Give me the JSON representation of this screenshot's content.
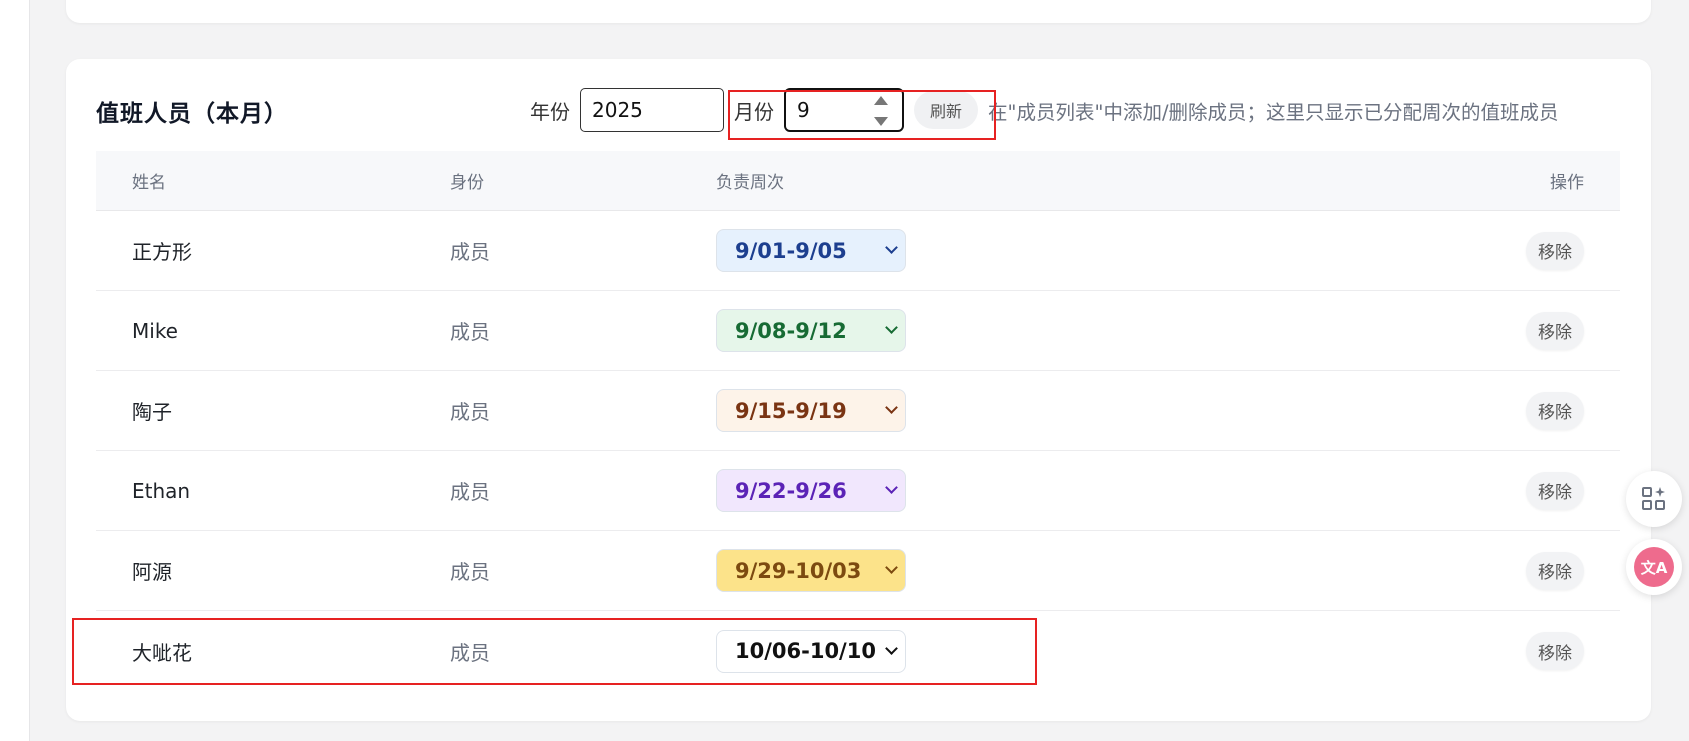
{
  "section": {
    "title": "值班人员（本月）"
  },
  "toolbar": {
    "year_label": "年份",
    "year_value": "2025",
    "month_label": "月份",
    "month_value": "9",
    "refresh_label": "刷新",
    "hint": "在\"成员列表\"中添加/删除成员；这里只显示已分配周次的值班成员"
  },
  "table": {
    "headers": {
      "name": "姓名",
      "role": "身份",
      "week": "负责周次",
      "action": "操作"
    },
    "rows": [
      {
        "name": "正方形",
        "role": "成员",
        "week": "9/01-9/05",
        "week_bg": "#e6f1fd",
        "week_fg": "#1d3f8f",
        "action": "移除"
      },
      {
        "name": "Mike",
        "role": "成员",
        "week": "9/08-9/12",
        "week_bg": "#e6f6ea",
        "week_fg": "#176b34",
        "action": "移除"
      },
      {
        "name": "陶子",
        "role": "成员",
        "week": "9/15-9/19",
        "week_bg": "#fdf3e9",
        "week_fg": "#7a3413",
        "action": "移除"
      },
      {
        "name": "Ethan",
        "role": "成员",
        "week": "9/22-9/26",
        "week_bg": "#f1e7fd",
        "week_fg": "#5b23b6",
        "action": "移除"
      },
      {
        "name": "阿源",
        "role": "成员",
        "week": "9/29-10/03",
        "week_bg": "#fce38a",
        "week_fg": "#7c4a10",
        "action": "移除"
      },
      {
        "name": "大呲花",
        "role": "成员",
        "week": "10/06-10/10",
        "week_bg": "#ffffff",
        "week_fg": "#111111",
        "action": "移除"
      }
    ]
  },
  "side": {
    "apps_icon": "apps-sparkle-icon",
    "translate_icon": "translate-icon",
    "translate_glyph": "文A"
  },
  "colors": {
    "highlight": "#e62222"
  }
}
